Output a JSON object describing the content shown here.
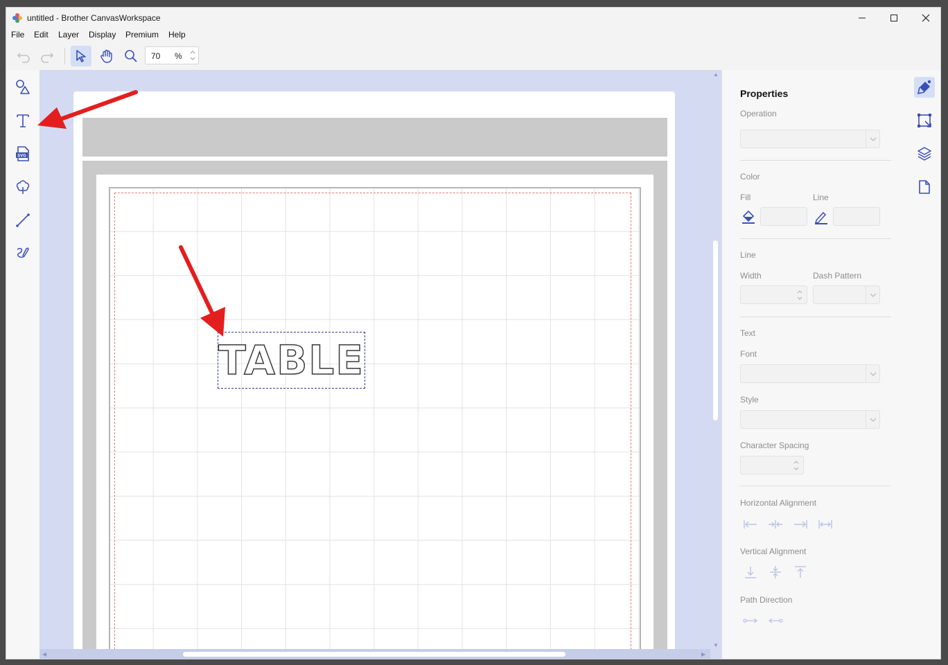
{
  "window": {
    "title": "untitled - Brother CanvasWorkspace",
    "controls": [
      "minimize",
      "maximize",
      "close"
    ]
  },
  "menu": [
    "File",
    "Edit",
    "Layer",
    "Display",
    "Premium",
    "Help"
  ],
  "toolbar": {
    "zoom_value": "70",
    "zoom_unit": "%",
    "icons": [
      "undo-icon",
      "redo-icon",
      "select-pointer-icon",
      "hand-pan-icon",
      "zoom-magnifier-icon"
    ]
  },
  "left_tools": [
    "shapes-icon",
    "text-icon",
    "svg-import-icon",
    "tree-shape-icon",
    "line-icon",
    "freehand-icon"
  ],
  "canvas": {
    "text_object": "TABLE",
    "colors": {
      "background": "#d3daf1",
      "mat": "#cacaca",
      "cut_margin": "#e07a6a",
      "selection": "#2b3a8f"
    }
  },
  "properties": {
    "title": "Properties",
    "operation_label": "Operation",
    "color_heading": "Color",
    "fill_label": "Fill",
    "line_label": "Line",
    "line_heading": "Line",
    "width_label": "Width",
    "dash_label": "Dash Pattern",
    "text_heading": "Text",
    "font_label": "Font",
    "style_label": "Style",
    "char_spacing_label": "Character Spacing",
    "h_align_label": "Horizontal Alignment",
    "v_align_label": "Vertical Alignment",
    "path_dir_label": "Path Direction"
  },
  "right_tabs": [
    "properties-brush-icon",
    "transform-icon",
    "layers-icon",
    "page-icon"
  ],
  "annotations": {
    "arrow_color": "#e31e1e"
  }
}
